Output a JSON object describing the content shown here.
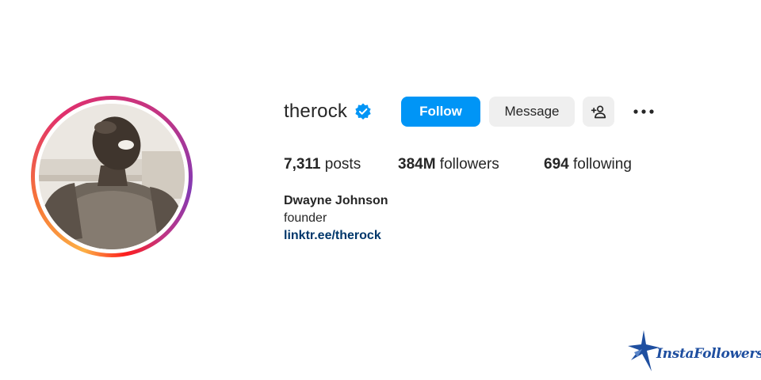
{
  "profile": {
    "username": "therock",
    "verified": true,
    "avatar_alt": "profile photo"
  },
  "actions": {
    "follow_label": "Follow",
    "message_label": "Message",
    "suggest_icon": "person-add-icon",
    "more_icon": "more-horizontal-icon"
  },
  "stats": {
    "posts_count": "7,311",
    "posts_label": " posts",
    "followers_count": "384M",
    "followers_label": " followers",
    "following_count": "694",
    "following_label": " following"
  },
  "bio": {
    "full_name": "Dwayne Johnson",
    "category": "founder",
    "link": "linktr.ee/therock"
  },
  "watermark": {
    "text": "InstaFollowers"
  },
  "colors": {
    "follow_button": "#0095f6",
    "secondary_button": "#efefef",
    "verified_badge": "#0095f6",
    "link": "#00376b",
    "watermark": "#1f4fa0"
  }
}
